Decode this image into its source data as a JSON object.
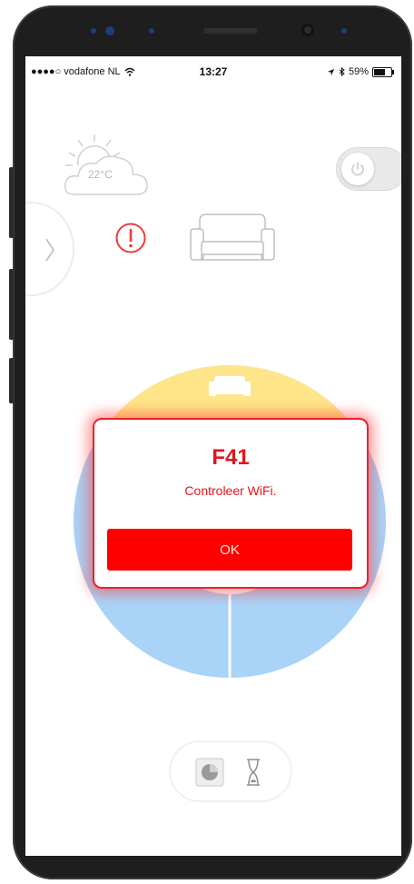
{
  "status_bar": {
    "carrier": "●●●●○ vodafone NL",
    "time": "13:27",
    "battery": "59%",
    "battery_level": 0.59
  },
  "weather": {
    "temperature": "22°C",
    "icon": "cloud-sun-icon"
  },
  "power": {
    "icon": "power-icon"
  },
  "alert": {
    "icon": "warning-icon"
  },
  "mode": {
    "icon": "sofa-icon"
  },
  "dialog": {
    "title": "F41",
    "message": "Controleer WiFi.",
    "button": "OK"
  },
  "colors": {
    "accent_red": "#ff0000",
    "wheel_yellow": "#ffe58a",
    "wheel_blue": "#a9d3f7"
  },
  "bottom_control": {
    "icons": [
      "pie-chart-icon",
      "hourglass-icon"
    ]
  }
}
